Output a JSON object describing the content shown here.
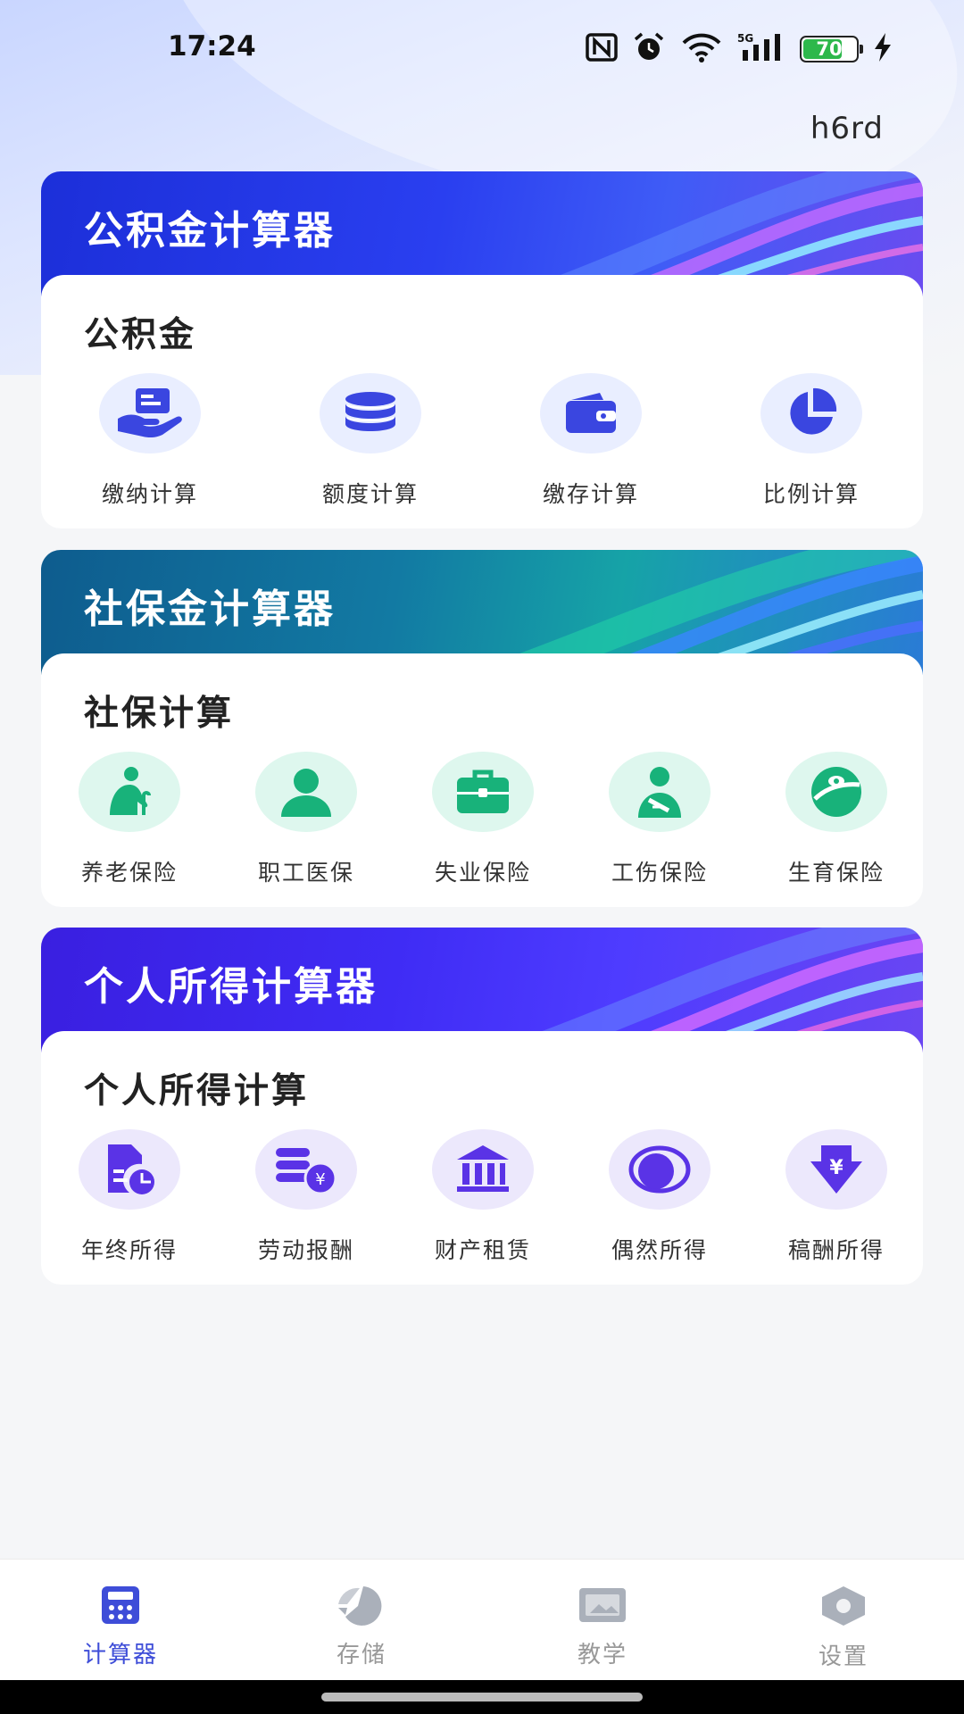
{
  "status_bar": {
    "time": "17:24",
    "battery_level": "70",
    "network": "5G",
    "icons": [
      "nfc-icon",
      "alarm-icon",
      "wifi-icon",
      "signal-5g-icon",
      "battery-icon",
      "charging-icon"
    ]
  },
  "header": {
    "user_code": "h6rd"
  },
  "colors": {
    "accent": "#3e4dd8",
    "fund_icon": "#3a46e0",
    "fund_bubble": "#e9eeff",
    "social_icon": "#18b27a",
    "social_bubble": "#def7ee",
    "income_icon": "#5a33e6",
    "income_bubble": "#ece8fc"
  },
  "sections": [
    {
      "banner_title": "公积金计算器",
      "title": "公积金",
      "items": [
        {
          "label": "缴纳计算",
          "icon": "hand-card-icon"
        },
        {
          "label": "额度计算",
          "icon": "database-icon"
        },
        {
          "label": "缴存计算",
          "icon": "wallet-icon"
        },
        {
          "label": "比例计算",
          "icon": "pie-icon"
        }
      ]
    },
    {
      "banner_title": "社保金计算器",
      "title": "社保计算",
      "items": [
        {
          "label": "养老保险",
          "icon": "elder-icon"
        },
        {
          "label": "职工医保",
          "icon": "person-icon"
        },
        {
          "label": "失业保险",
          "icon": "briefcase-icon"
        },
        {
          "label": "工伤保险",
          "icon": "injury-icon"
        },
        {
          "label": "生育保险",
          "icon": "baby-icon"
        }
      ]
    },
    {
      "banner_title": "个人所得计算器",
      "title": "个人所得计算",
      "items": [
        {
          "label": "年终所得",
          "icon": "report-icon"
        },
        {
          "label": "劳动报酬",
          "icon": "coins-icon"
        },
        {
          "label": "财产租赁",
          "icon": "bank-icon"
        },
        {
          "label": "偶然所得",
          "icon": "planet-icon"
        },
        {
          "label": "稿酬所得",
          "icon": "yen-down-icon"
        }
      ]
    }
  ],
  "tabbar": [
    {
      "label": "计算器",
      "icon": "calculator-icon",
      "active": true
    },
    {
      "label": "存储",
      "icon": "storage-icon",
      "active": false
    },
    {
      "label": "教学",
      "icon": "teaching-icon",
      "active": false
    },
    {
      "label": "设置",
      "icon": "settings-icon",
      "active": false
    }
  ]
}
